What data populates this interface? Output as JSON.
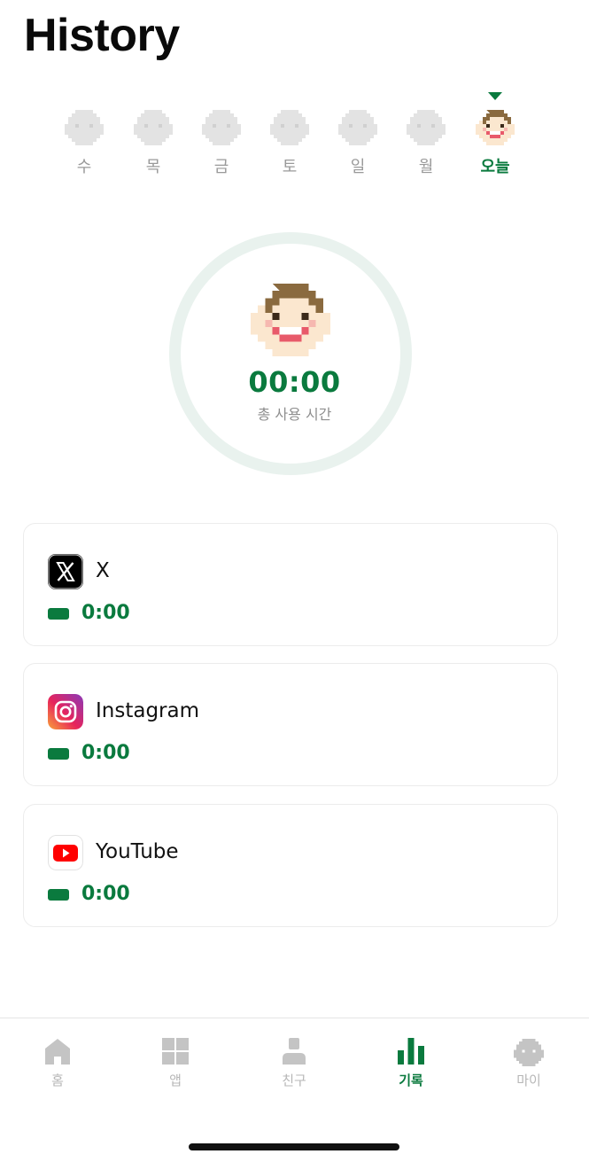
{
  "header": {
    "title": "History"
  },
  "days": [
    {
      "label": "수",
      "active": false
    },
    {
      "label": "목",
      "active": false
    },
    {
      "label": "금",
      "active": false
    },
    {
      "label": "토",
      "active": false
    },
    {
      "label": "일",
      "active": false
    },
    {
      "label": "월",
      "active": false
    },
    {
      "label": "오늘",
      "active": true
    }
  ],
  "summary": {
    "total_time": "00:00",
    "total_label": "총 사용 시간"
  },
  "apps": [
    {
      "name": "X",
      "usage": "0:00",
      "icon": "x-logo-icon"
    },
    {
      "name": "Instagram",
      "usage": "0:00",
      "icon": "instagram-logo-icon"
    },
    {
      "name": "YouTube",
      "usage": "0:00",
      "icon": "youtube-logo-icon"
    }
  ],
  "tabs": [
    {
      "label": "홈",
      "icon": "home-icon",
      "active": false
    },
    {
      "label": "앱",
      "icon": "grid-icon",
      "active": false
    },
    {
      "label": "친구",
      "icon": "person-icon",
      "active": false
    },
    {
      "label": "기록",
      "icon": "bar-chart-icon",
      "active": true
    },
    {
      "label": "마이",
      "icon": "face-icon",
      "active": false
    }
  ],
  "colors": {
    "accent": "#0a7a3e",
    "inactive": "#b7b7b7",
    "ring": "#e9f2ee"
  }
}
